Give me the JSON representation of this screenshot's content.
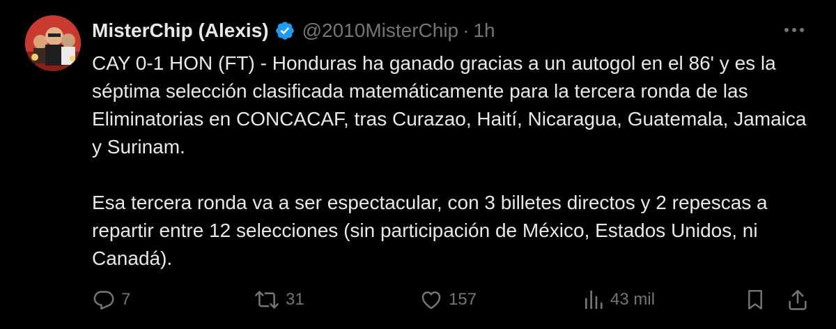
{
  "author": {
    "display_name": "MisterChip (Alexis)",
    "handle": "@2010MisterChip",
    "separator": "·",
    "time": "1h",
    "verified": true,
    "avatar_icon": "avatar-illustration"
  },
  "tweet": {
    "paragraphs": [
      "CAY 0-1 HON (FT) - Honduras ha ganado gracias a un autogol en el 86' y es la séptima selección clasificada matemáticamente para la tercera ronda de las Eliminatorias en CONCACAF, tras Curazao, Haití, Nicaragua, Guatemala, Jamaica y Surinam.",
      "Esa tercera ronda va a ser espectacular, con 3 billetes directos y 2 repescas a repartir entre 12 selecciones (sin participación de México, Estados Unidos, ni Canadá)."
    ]
  },
  "actions": {
    "reply": {
      "icon": "reply-icon",
      "count": "7"
    },
    "retweet": {
      "icon": "retweet-icon",
      "count": "31"
    },
    "like": {
      "icon": "heart-icon",
      "count": "157"
    },
    "views": {
      "icon": "views-icon",
      "count": "43 mil"
    },
    "bookmark": {
      "icon": "bookmark-icon"
    },
    "share": {
      "icon": "share-icon"
    }
  },
  "colors": {
    "background": "#000000",
    "text_primary": "#e7e9ea",
    "text_secondary": "#71767b",
    "verified_badge": "#1d9bf0"
  }
}
